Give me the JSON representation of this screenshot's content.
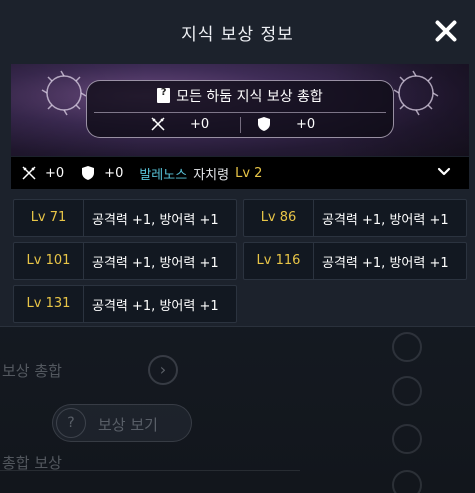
{
  "background": {
    "texts": [
      "보상 총합",
      "보상 보기",
      "총합 보상"
    ],
    "arrow_glyph": "›",
    "help_glyph": "?"
  },
  "modal": {
    "title": "지식 보상 정보",
    "banner": {
      "heading": "모든 하둠 지식 보상 총합",
      "attack": "+0",
      "defense": "+0"
    },
    "region": {
      "attack": "+0",
      "defense": "+0",
      "name": "발레노스",
      "title": "자치령",
      "level": "Lv 2"
    },
    "rewards": [
      {
        "level": "Lv 71",
        "desc": "공격력 +1, 방어력 +1"
      },
      {
        "level": "Lv 86",
        "desc": "공격력 +1, 방어력 +1"
      },
      {
        "level": "Lv 101",
        "desc": "공격력 +1, 방어력 +1"
      },
      {
        "level": "Lv 116",
        "desc": "공격력 +1, 방어력 +1"
      },
      {
        "level": "Lv 131",
        "desc": "공격력 +1, 방어력 +1"
      }
    ]
  },
  "colors": {
    "accent_gold": "#e8c547",
    "region_cyan": "#59c3d9",
    "panel": "#1c222c",
    "card": "#121821"
  },
  "icons": [
    "close-icon",
    "book-icon",
    "sword-icon",
    "shield-icon",
    "chevron-down-icon"
  ]
}
